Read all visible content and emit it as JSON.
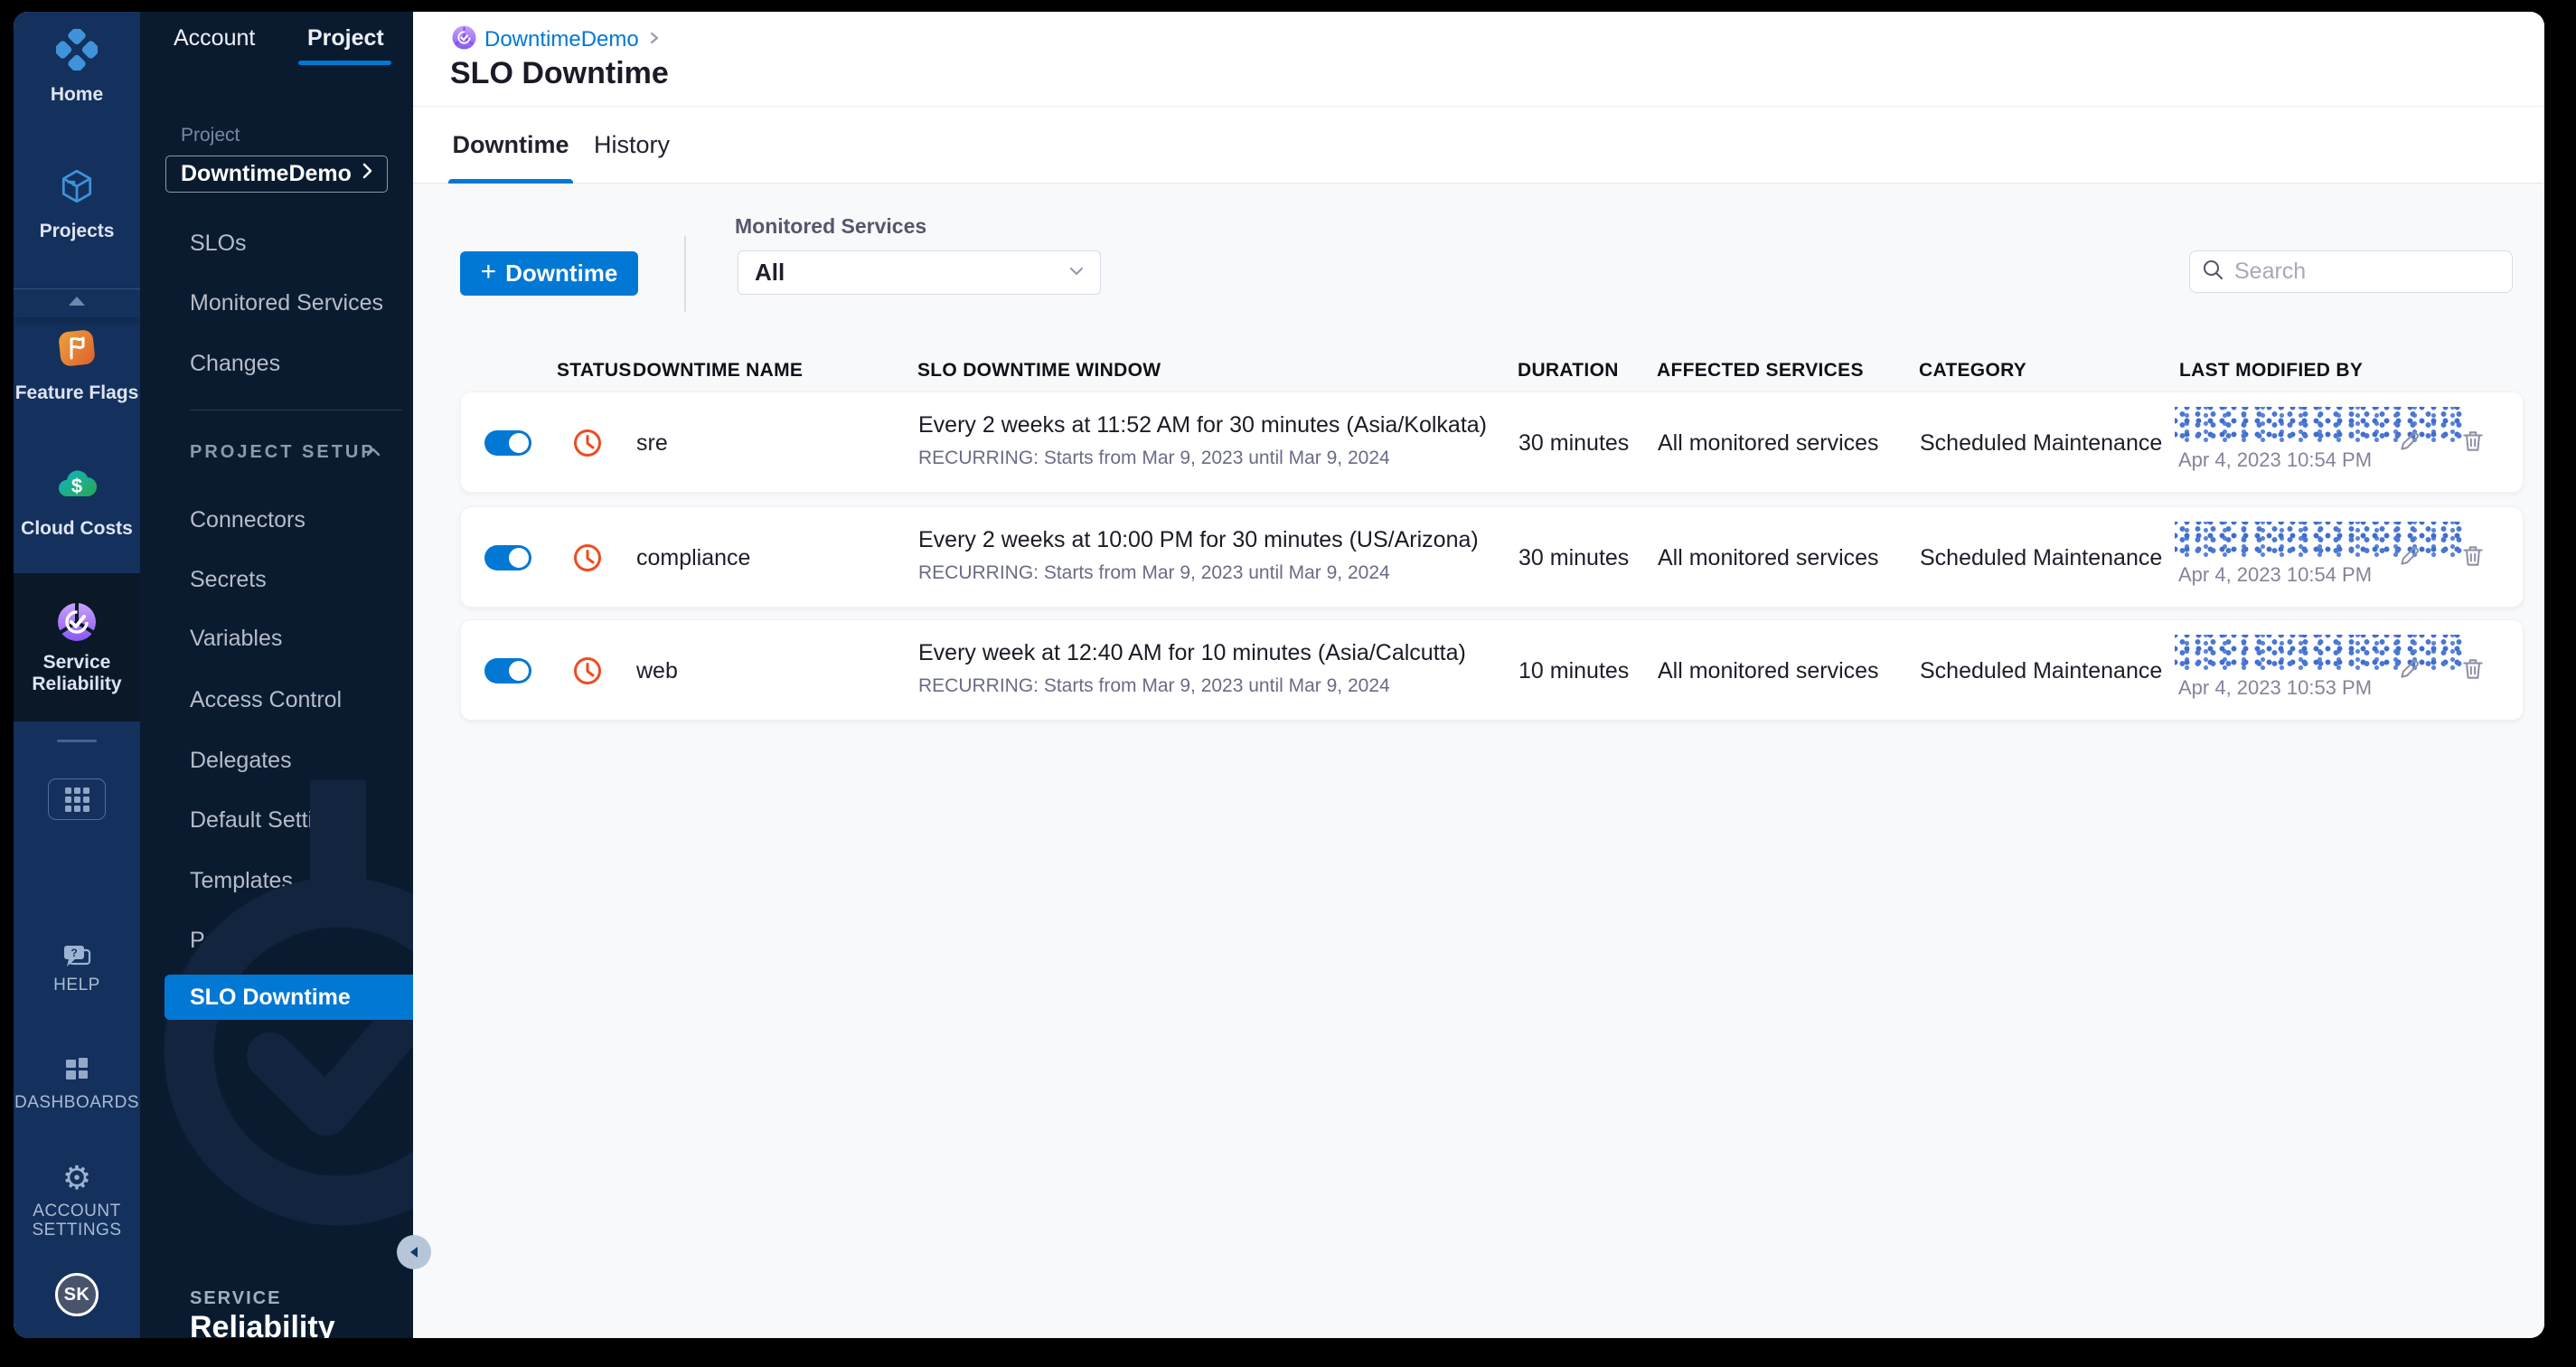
{
  "colors": {
    "accent": "#0278d5",
    "clock_icon": "#ee4c20",
    "link": "#0278d5"
  },
  "module_nav": {
    "items": [
      {
        "label": "Home"
      },
      {
        "label": "Projects"
      },
      {
        "label": "Feature Flags"
      },
      {
        "label": "Cloud Costs"
      },
      {
        "label": "Service Reliability"
      }
    ],
    "bottom_items": [
      {
        "label": "HELP"
      },
      {
        "label": "DASHBOARDS"
      },
      {
        "label": "ACCOUNT SETTINGS"
      }
    ],
    "avatar_initials": "SK"
  },
  "sidebar": {
    "tabs": [
      {
        "label": "Account"
      },
      {
        "label": "Project"
      }
    ],
    "active_tab": "Project",
    "project_label": "Project",
    "project_name": "DowntimeDemo",
    "items": [
      {
        "label": "SLOs"
      },
      {
        "label": "Monitored Services"
      },
      {
        "label": "Changes"
      }
    ],
    "setup_heading": "PROJECT SETUP",
    "setup_items": [
      {
        "label": "Connectors"
      },
      {
        "label": "Secrets"
      },
      {
        "label": "Variables"
      },
      {
        "label": "Access Control"
      },
      {
        "label": "Delegates"
      },
      {
        "label": "Default Settings"
      },
      {
        "label": "Templates"
      },
      {
        "label": "Policies"
      }
    ],
    "active_item": "SLO Downtime",
    "brand_top": "SERVICE",
    "brand_bottom": "Reliability"
  },
  "header": {
    "breadcrumb_project": "DowntimeDemo",
    "title": "SLO Downtime",
    "tabs": [
      {
        "label": "Downtime"
      },
      {
        "label": "History"
      }
    ],
    "active_page_tab": "Downtime"
  },
  "toolbar": {
    "add_plus": "+",
    "add_label": "Downtime",
    "filter_label": "Monitored Services",
    "filter_value": "All",
    "search_placeholder": "Search"
  },
  "table": {
    "columns": [
      "STATUS",
      "DOWNTIME NAME",
      "SLO DOWNTIME WINDOW",
      "DURATION",
      "AFFECTED SERVICES",
      "CATEGORY",
      "LAST MODIFIED BY"
    ],
    "rows": [
      {
        "enabled": true,
        "name": "sre",
        "window": "Every 2 weeks at 11:52 AM for 30 minutes (Asia/Kolkata)",
        "recurring": "RECURRING: Starts from Mar 9, 2023 until Mar 9, 2024",
        "duration": "30 minutes",
        "affected": "All monitored services",
        "category": "Scheduled Maintenance",
        "modified": "Apr 4, 2023 10:54 PM"
      },
      {
        "enabled": true,
        "name": "compliance",
        "window": "Every 2 weeks at 10:00 PM for 30 minutes (US/Arizona)",
        "recurring": "RECURRING: Starts from Mar 9, 2023 until Mar 9, 2024",
        "duration": "30 minutes",
        "affected": "All monitored services",
        "category": "Scheduled Maintenance",
        "modified": "Apr 4, 2023 10:54 PM"
      },
      {
        "enabled": true,
        "name": "web",
        "window": "Every week at 12:40 AM for 10 minutes (Asia/Calcutta)",
        "recurring": "RECURRING: Starts from Mar 9, 2023 until Mar 9, 2024",
        "duration": "10 minutes",
        "affected": "All monitored services",
        "category": "Scheduled Maintenance",
        "modified": "Apr 4, 2023 10:53 PM"
      }
    ]
  }
}
